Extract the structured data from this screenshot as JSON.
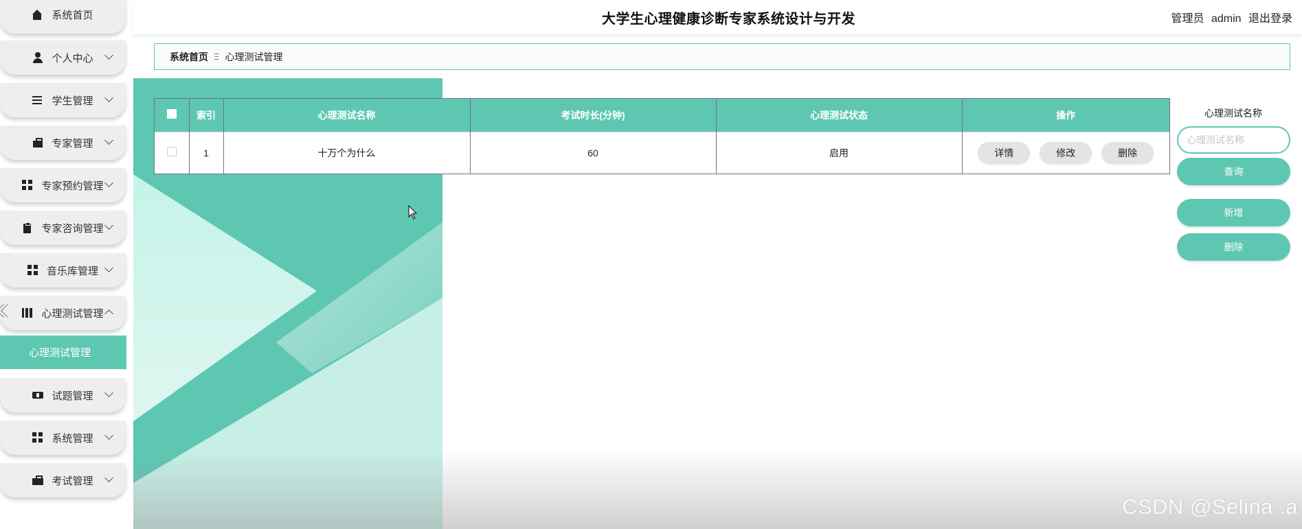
{
  "header": {
    "title": "大学生心理健康诊断专家系统设计与开发",
    "role": "管理员",
    "username": "admin",
    "logout": "退出登录"
  },
  "sidebar": {
    "items": [
      {
        "label": "系统首页",
        "icon": "home-icon"
      },
      {
        "label": "个人中心",
        "icon": "user-icon"
      },
      {
        "label": "学生管理",
        "icon": "list-icon"
      },
      {
        "label": "专家管理",
        "icon": "briefcase-icon"
      },
      {
        "label": "专家预约管理",
        "icon": "grid-icon"
      },
      {
        "label": "专家咨询管理",
        "icon": "clipboard-icon"
      },
      {
        "label": "音乐库管理",
        "icon": "grid-icon"
      },
      {
        "label": "心理测试管理",
        "icon": "book-icon",
        "expanded": true
      },
      {
        "label": "试题管理",
        "icon": "ticket-icon"
      },
      {
        "label": "系统管理",
        "icon": "grid-icon"
      },
      {
        "label": "考试管理",
        "icon": "bag-icon"
      }
    ],
    "active_sub": "心理测试管理"
  },
  "breadcrumb": {
    "home": "系统首页",
    "separator": "Ξ",
    "current": "心理测试管理"
  },
  "table": {
    "columns": [
      "",
      "索引",
      "心理测试名称",
      "考试时长(分钟)",
      "心理测试状态",
      "操作"
    ],
    "rows": [
      {
        "index": "1",
        "name": "十万个为什么",
        "duration": "60",
        "status": "启用"
      }
    ],
    "actions": {
      "detail": "详情",
      "edit": "修改",
      "delete": "删除"
    }
  },
  "search": {
    "label": "心理测试名称",
    "placeholder": "心理测试名称",
    "value": "",
    "query_button": "查询",
    "add_button": "新增",
    "delete_button": "删除"
  },
  "theme": {
    "accent": "#5ec7b2",
    "accent_light": "#c8f2e8"
  },
  "watermark": "CSDN @Selina .a"
}
